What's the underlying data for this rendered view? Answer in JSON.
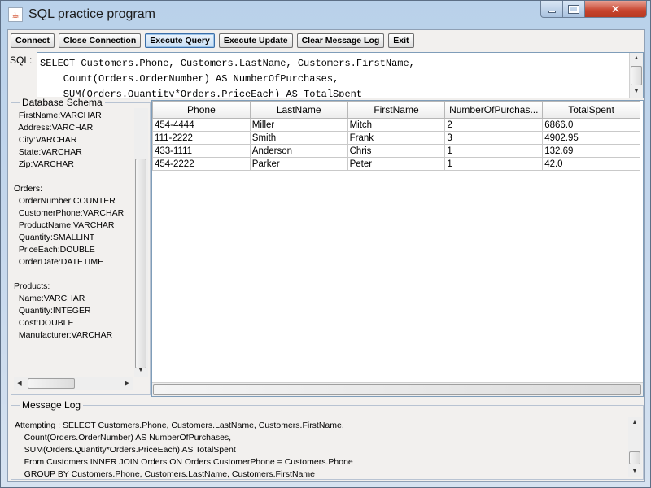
{
  "window": {
    "title": "SQL practice program",
    "icon": "java-cup-icon"
  },
  "toolbar": {
    "connect": "Connect",
    "close_connection": "Close Connection",
    "execute_query": "Execute Query",
    "execute_update": "Execute Update",
    "clear_log": "Clear Message Log",
    "exit": "Exit"
  },
  "sql": {
    "label": "SQL:",
    "text": "SELECT Customers.Phone, Customers.LastName, Customers.FirstName,\n    Count(Orders.OrderNumber) AS NumberOfPurchases,\n    SUM(Orders.Quantity*Orders.PriceEach) AS TotalSpent"
  },
  "schema": {
    "title": "Database Schema",
    "lines": [
      "  FirstName:VARCHAR",
      "  Address:VARCHAR",
      "  City:VARCHAR",
      "  State:VARCHAR",
      "  Zip:VARCHAR",
      "",
      "Orders:",
      "  OrderNumber:COUNTER",
      "  CustomerPhone:VARCHAR",
      "  ProductName:VARCHAR",
      "  Quantity:SMALLINT",
      "  PriceEach:DOUBLE",
      "  OrderDate:DATETIME",
      "",
      "Products:",
      "  Name:VARCHAR",
      "  Quantity:INTEGER",
      "  Cost:DOUBLE",
      "  Manufacturer:VARCHAR"
    ]
  },
  "results": {
    "columns": [
      "Phone",
      "LastName",
      "FirstName",
      "NumberOfPurchas...",
      "TotalSpent"
    ],
    "rows": [
      [
        "454-4444",
        "Miller",
        "Mitch",
        "2",
        "6866.0"
      ],
      [
        "111-2222",
        "Smith",
        "Frank",
        "3",
        "4902.95"
      ],
      [
        "433-1111",
        "Anderson",
        "Chris",
        "1",
        "132.69"
      ],
      [
        "454-2222",
        "Parker",
        "Peter",
        "1",
        "42.0"
      ]
    ]
  },
  "message_log": {
    "title": "Message Log",
    "lines": [
      "Attempting : SELECT Customers.Phone, Customers.LastName, Customers.FirstName,",
      "    Count(Orders.OrderNumber) AS NumberOfPurchases,",
      "    SUM(Orders.Quantity*Orders.PriceEach) AS TotalSpent",
      "    From Customers INNER JOIN Orders ON Orders.CustomerPhone = Customers.Phone",
      "    GROUP BY Customers.Phone, Customers.LastName, Customers.FirstName"
    ]
  }
}
